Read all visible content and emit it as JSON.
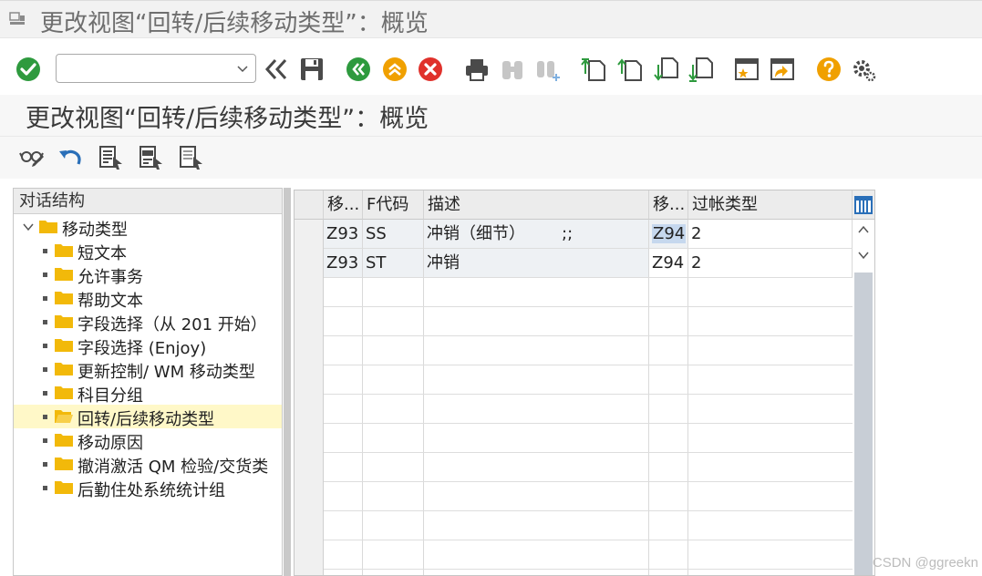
{
  "window": {
    "title": "更改视图“回转/后续移动类型”：概览"
  },
  "toolbar": {
    "command_field": {
      "value": "",
      "placeholder": ""
    },
    "icons": [
      "enter-icon",
      "back-icon",
      "save-icon",
      "back-green-icon",
      "exit-icon",
      "cancel-icon",
      "print-icon",
      "find-icon",
      "find-next-icon",
      "first-page-icon",
      "previous-page-icon",
      "next-page-icon",
      "last-page-icon",
      "create-session-icon",
      "shortcut-icon",
      "help-icon",
      "customize-icon"
    ]
  },
  "page": {
    "title": "更改视图“回转/后续移动类型”：概览"
  },
  "app_toolbar": {
    "icons": [
      "display-change-icon",
      "undo-icon",
      "select-all-icon",
      "select-block-icon",
      "deselect-all-icon"
    ]
  },
  "tree": {
    "header": "对话结构",
    "root": "移动类型",
    "items": [
      {
        "label": "短文本",
        "selected": false
      },
      {
        "label": "允许事务",
        "selected": false
      },
      {
        "label": "帮助文本",
        "selected": false
      },
      {
        "label": "字段选择（从 201 开始）",
        "selected": false
      },
      {
        "label": "字段选择 (Enjoy)",
        "selected": false
      },
      {
        "label": "更新控制/ WM 移动类型",
        "selected": false
      },
      {
        "label": "科目分组",
        "selected": false
      },
      {
        "label": "回转/后续移动类型",
        "selected": true
      },
      {
        "label": "移动原因",
        "selected": false
      },
      {
        "label": "撤消激活 QM 检验/交货类",
        "selected": false
      },
      {
        "label": "后勤住处系统统计组",
        "selected": false
      }
    ]
  },
  "table": {
    "columns": [
      "移...",
      "F代码",
      "描述",
      "移...",
      "过帐类型"
    ],
    "rows": [
      [
        "Z93",
        "SS",
        "冲销（细节）       ;;",
        "Z94",
        "2"
      ],
      [
        "Z93",
        "ST",
        "冲销",
        "Z94",
        "2"
      ]
    ]
  },
  "watermark": "CSDN @ggreekn",
  "colors": {
    "accent_green": "#2e9a3e",
    "accent_orange": "#f0a000",
    "cancel_red": "#e0312b",
    "folder_yellow": "#f2b90a",
    "selection_yellow": "#fff8c8"
  }
}
